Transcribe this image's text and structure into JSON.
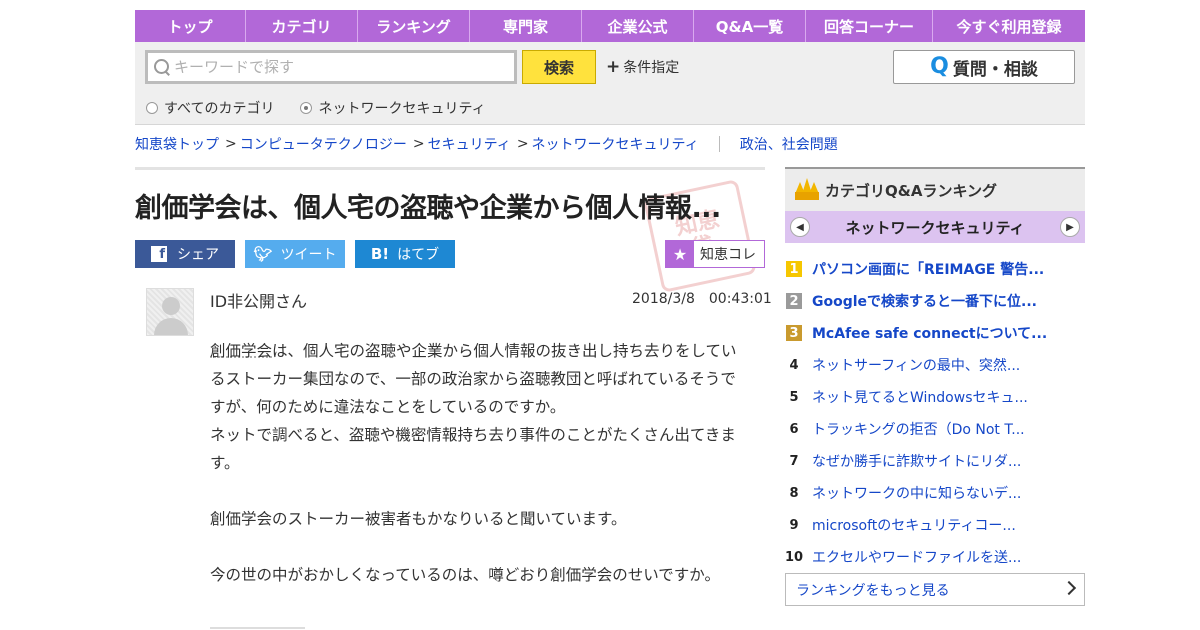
{
  "nav": {
    "items": [
      "トップ",
      "カテゴリ",
      "ランキング",
      "専門家",
      "企業公式",
      "Q&A一覧",
      "回答コーナー",
      "今すぐ利用登録"
    ]
  },
  "search": {
    "placeholder": "キーワードで探す",
    "button": "検索",
    "condition": "条件指定",
    "ask_button": "質問・相談",
    "radio_all": "すべてのカテゴリ",
    "radio_current": "ネットワークセキュリティ",
    "selected": "ネットワークセキュリティ"
  },
  "breadcrumb": {
    "items": [
      "知恵袋トップ",
      "コンピュータテクノロジー",
      "セキュリティ",
      "ネットワークセキュリティ"
    ],
    "related": "政治、社会問題"
  },
  "question": {
    "title": "創価学会は、個人宅の盗聴や企業から個人情報...",
    "share": {
      "facebook": "シェア",
      "twitter": "ツイート",
      "hatena": "はてブ"
    },
    "chiekore": "知恵コレ",
    "user": "ID非公開さん",
    "date": "2018/3/8　00:43:01",
    "body": {
      "p1_link": "創価学会",
      "p1_rest": "は、個人宅の盗聴や企業から個人情報の抜き出し持ち去りをしているストーカー集団なので、一部の政治家から盗聴教団と呼ばれているそうですが、何のために違法なことをしているのですか。",
      "p2": "ネットで調べると、盗聴や機密情報持ち去り事件のことがたくさん出てきます。",
      "p3": "創価学会のストーカー被害者もかなりいると聞いています。",
      "p4": "今の世の中がおかしくなっているのは、噂どおり創価学会のせいですか。"
    }
  },
  "ranking": {
    "header": "カテゴリQ&Aランキング",
    "category": "ネットワークセキュリティ",
    "items": [
      {
        "rank": "1",
        "text": "パソコン画面に「REIMAGE 警告..."
      },
      {
        "rank": "2",
        "text": "Googleで検索すると一番下に位..."
      },
      {
        "rank": "3",
        "text": "McAfee safe connectについて..."
      },
      {
        "rank": "4",
        "text": "ネットサーフィンの最中、突然..."
      },
      {
        "rank": "5",
        "text": "ネット見てるとWindowsセキュ..."
      },
      {
        "rank": "6",
        "text": "トラッキングの拒否（Do Not T..."
      },
      {
        "rank": "7",
        "text": "なぜか勝手に詐欺サイトにリダ..."
      },
      {
        "rank": "8",
        "text": "ネットワークの中に知らないデ..."
      },
      {
        "rank": "9",
        "text": "microsoftのセキュリティコー..."
      },
      {
        "rank": "10",
        "text": "エクセルやワードファイルを送..."
      }
    ],
    "more": "ランキングをもっと見る"
  },
  "colors": {
    "nav_bg": "#b268d8",
    "search_button": "#ffe23d",
    "link": "#1547c8",
    "rank_sub_bg": "#dcc3f0"
  }
}
